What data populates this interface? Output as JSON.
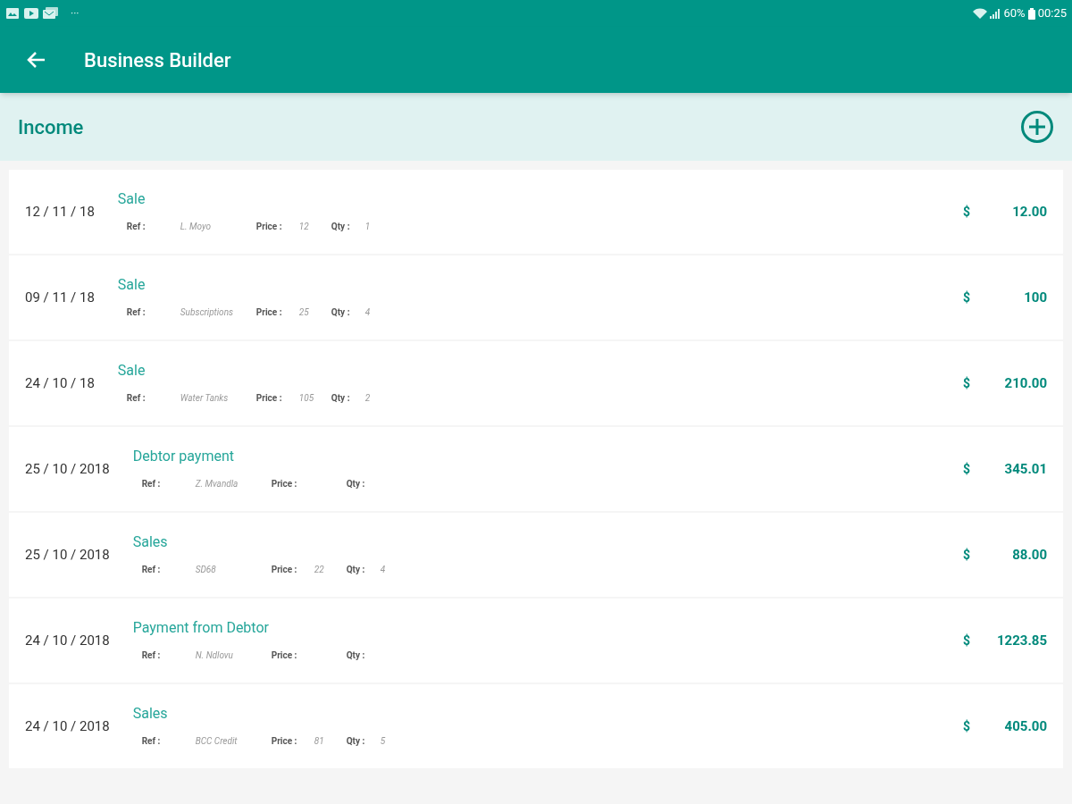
{
  "status_bar": {
    "overflow": "···",
    "battery": "60%",
    "time": "00:25"
  },
  "app_bar": {
    "title": "Business Builder"
  },
  "section": {
    "title": "Income"
  },
  "entries": [
    {
      "date": "12 / 11 / 18",
      "title": "Sale",
      "ref_label": "Ref :",
      "ref": "L. Moyo",
      "price_label": "Price :",
      "price": "12",
      "qty_label": "Qty :",
      "qty": "1",
      "currency": "$",
      "amount": "12.00"
    },
    {
      "date": "09 / 11 / 18",
      "title": "Sale",
      "ref_label": "Ref :",
      "ref": "Subscriptions",
      "price_label": "Price :",
      "price": "25",
      "qty_label": "Qty :",
      "qty": "4",
      "currency": "$",
      "amount": "100"
    },
    {
      "date": "24 / 10 / 18",
      "title": "Sale",
      "ref_label": "Ref :",
      "ref": "Water Tanks",
      "price_label": "Price :",
      "price": "105",
      "qty_label": "Qty :",
      "qty": "2",
      "currency": "$",
      "amount": "210.00"
    },
    {
      "date": "25 / 10 / 2018",
      "title": "Debtor payment",
      "ref_label": "Ref :",
      "ref": "Z. Mvandla",
      "price_label": "Price :",
      "qty_label": "Qty :",
      "currency": "$",
      "amount": "345.01"
    },
    {
      "date": "25 / 10 / 2018",
      "title": "Sales",
      "ref_label": "Ref :",
      "ref": "SD68",
      "price_label": "Price :",
      "price": "22",
      "qty_label": "Qty :",
      "qty": "4",
      "currency": "$",
      "amount": "88.00"
    },
    {
      "date": "24 / 10 / 2018",
      "title": "Payment from Debtor",
      "ref_label": "Ref :",
      "ref": "N. Ndlovu",
      "price_label": "Price :",
      "qty_label": "Qty :",
      "currency": "$",
      "amount": "1223.85"
    },
    {
      "date": "24 / 10 / 2018",
      "title": "Sales",
      "ref_label": "Ref :",
      "ref": "BCC Credit",
      "price_label": "Price :",
      "price": "81",
      "qty_label": "Qty :",
      "qty": "5",
      "currency": "$",
      "amount": "405.00"
    }
  ]
}
